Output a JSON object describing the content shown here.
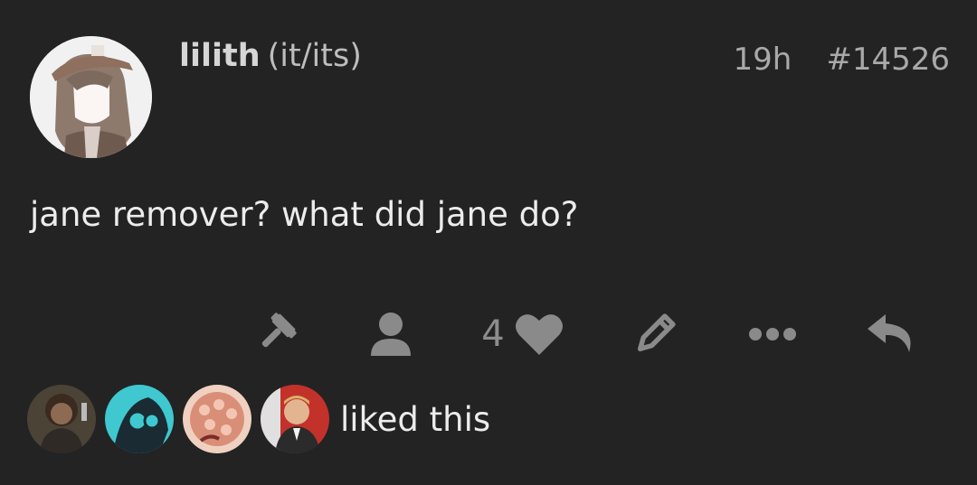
{
  "post": {
    "author_name": "lilith",
    "author_pronouns": "(it/its)",
    "age": "19h",
    "post_number": "#14526",
    "body": "jane remover? what did jane do?"
  },
  "actions": {
    "like_count": "4",
    "icons": [
      "gavel-icon",
      "user-icon",
      "heart-icon",
      "pencil-icon",
      "ellipsis-icon",
      "reply-icon"
    ]
  },
  "likers": {
    "text": "liked this",
    "count": 4
  },
  "colors": {
    "background": "#232323",
    "text": "#ececec",
    "muted": "#a9a9a9",
    "icon": "#8a8a8a"
  }
}
